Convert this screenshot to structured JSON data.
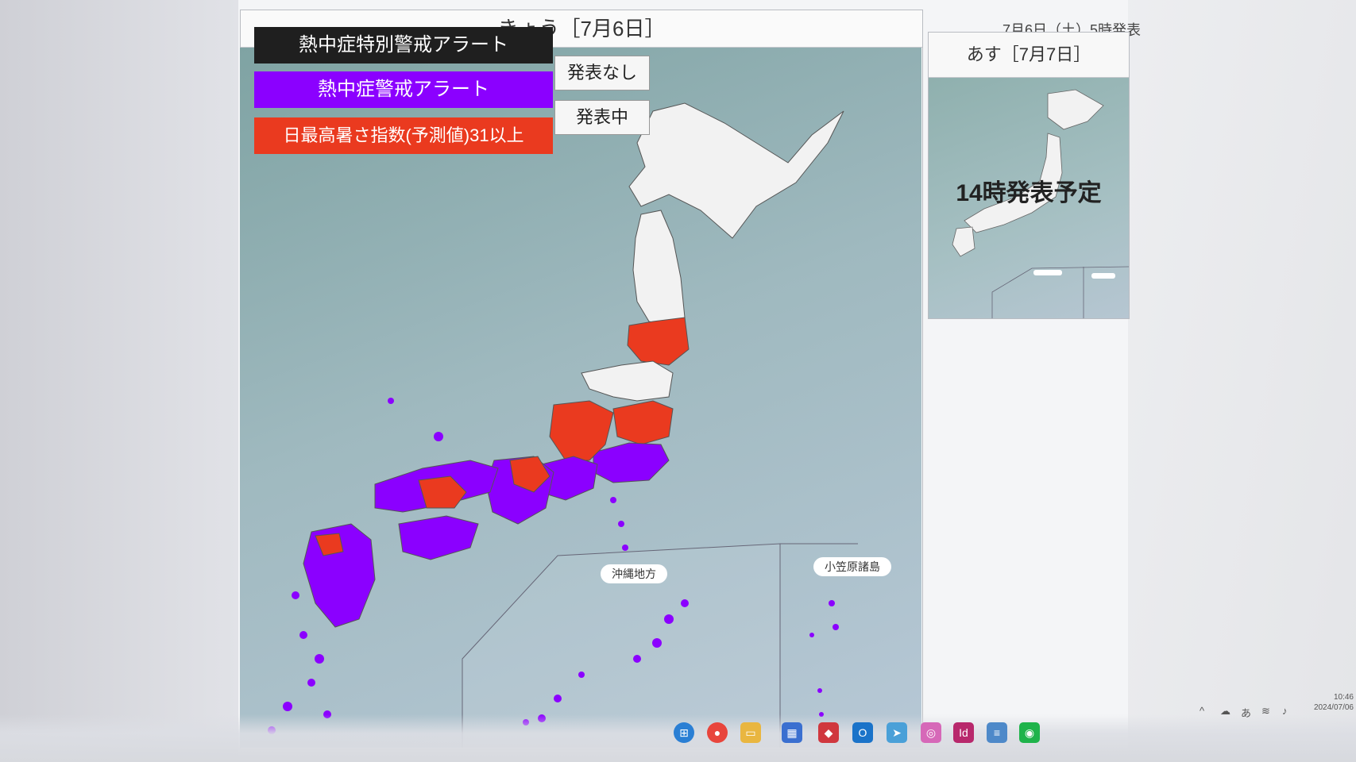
{
  "today": {
    "title": "きょう［7月6日］",
    "issue_time": "7月6日（土）5時発表"
  },
  "legend": {
    "special_alert": {
      "label": "熱中症特別警戒アラート",
      "status": "発表なし",
      "color": "#1f1f1f"
    },
    "heat_alert": {
      "label": "熱中症警戒アラート",
      "status": "発表中",
      "color": "#8b00ff"
    },
    "wbgt": {
      "label": "日最高暑さ指数(予測値)31以上",
      "color": "#ea3a1f"
    }
  },
  "insets": {
    "okinawa": "沖縄地方",
    "ogasawara": "小笠原諸島"
  },
  "tomorrow": {
    "title": "あす［7月7日］",
    "notice": "14時発表予定"
  },
  "colors": {
    "sea": "#9fb9bf",
    "land_default": "#f2f2f2",
    "alert_purple": "#8b00ff",
    "wbgt_red": "#ea3a1f"
  },
  "taskbar": {
    "icons": [
      "start-icon",
      "chrome-icon",
      "folder-icon",
      "store-icon",
      "shield-icon",
      "outlook-icon",
      "bird-icon",
      "camera-icon",
      "indesign-icon",
      "notepad-icon",
      "line-icon"
    ],
    "clock_time": "10:46",
    "clock_date": "2024/07/06"
  }
}
